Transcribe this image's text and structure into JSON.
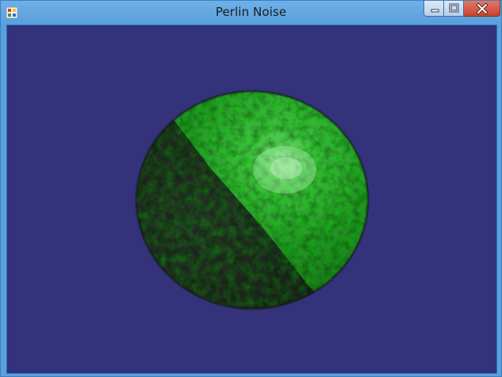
{
  "window": {
    "title": "Perlin Noise",
    "controls": {
      "minimize": "minimize-icon",
      "maximize": "maximize-icon",
      "close": "close-icon"
    }
  },
  "viewport": {
    "background_color": "#33327a",
    "object": "sphere",
    "object_color": "#2aa62a",
    "shadow_color": "#1c1e1c",
    "highlight_color": "#8fe88f"
  }
}
